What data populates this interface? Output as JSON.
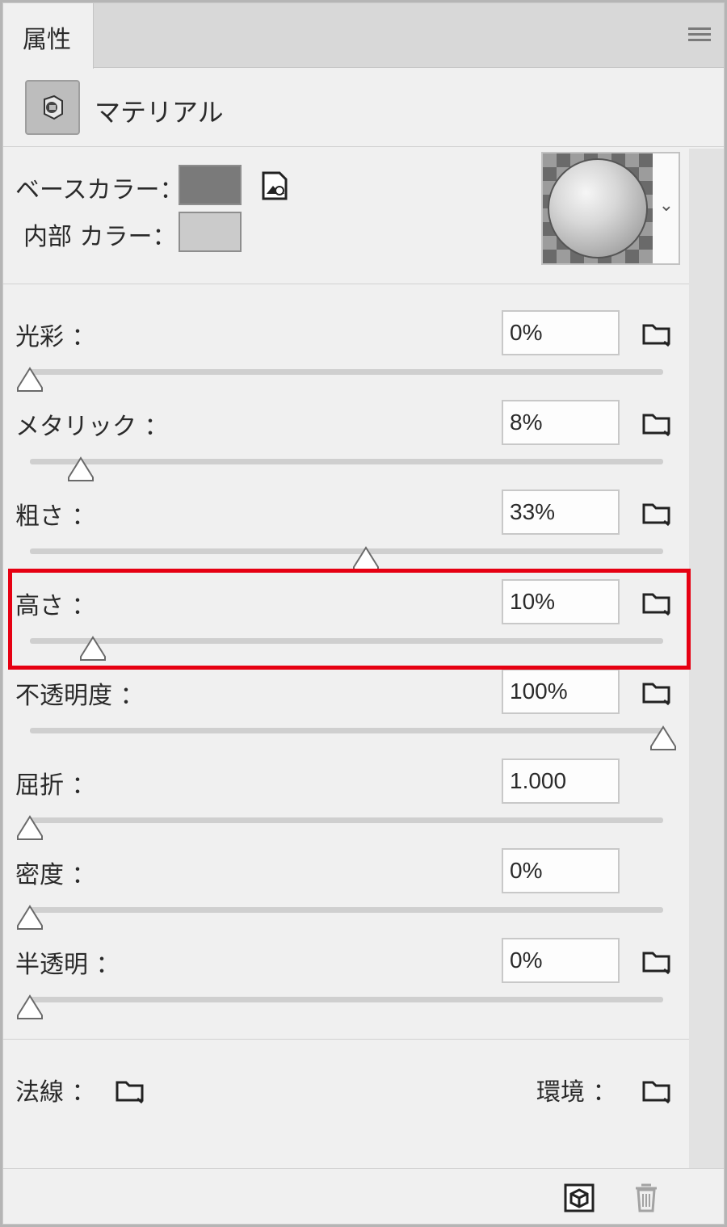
{
  "tab": {
    "label": "属性"
  },
  "material": {
    "title": "マテリアル"
  },
  "colors": {
    "base_label": "ベースカラー：",
    "base_color": "#7a7a7a",
    "inner_label": "内部 カラー：",
    "inner_color": "#cbcbcb"
  },
  "properties": [
    {
      "label": "光彩 ：",
      "value": "0%",
      "level": 0.0,
      "folder": true
    },
    {
      "label": "メタリック ：",
      "value": "8%",
      "level": 0.08,
      "folder": true
    },
    {
      "label": "粗さ ：",
      "value": "33%",
      "level": 0.53,
      "folder": true
    },
    {
      "label": "高さ ：",
      "value": "10%",
      "level": 0.1,
      "folder": true
    },
    {
      "label": "不透明度 ：",
      "value": "100%",
      "level": 1.0,
      "folder": true
    },
    {
      "label": "屈折 ：",
      "value": "1.000",
      "level": 0.0,
      "folder": false
    },
    {
      "label": "密度 ：",
      "value": "0%",
      "level": 0.0,
      "folder": false
    },
    {
      "label": "半透明 ：",
      "value": "0%",
      "level": 0.0,
      "folder": true
    }
  ],
  "maps": {
    "normal_label": "法線 ：",
    "environment_label": "環境 ："
  },
  "icons": {
    "menu": "panel-menu-icon",
    "material": "material-icon",
    "texture": "texture-edit-icon",
    "folder": "folder-icon",
    "new_material": "new-material-icon",
    "delete": "trash-icon"
  },
  "highlight_color": "#e60012"
}
